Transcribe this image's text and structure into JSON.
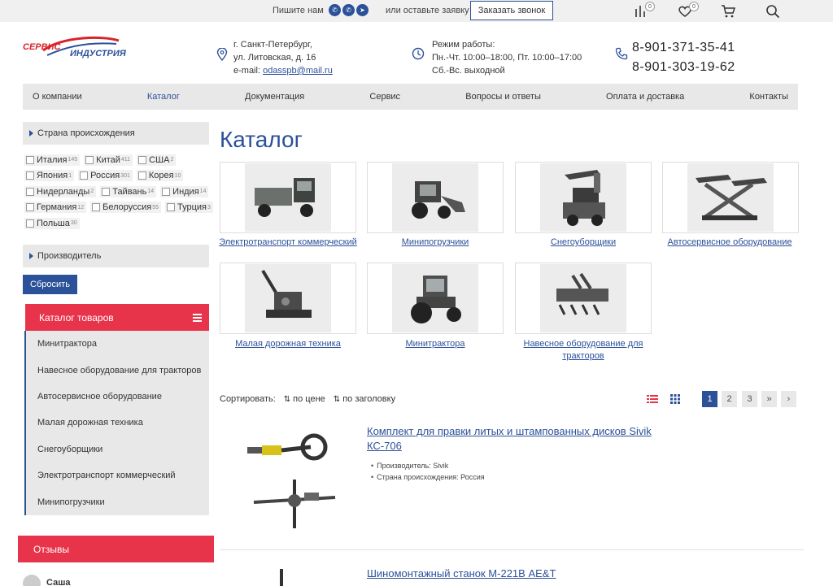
{
  "topbar": {
    "write_label": "Пишите нам",
    "messengers": [
      "whatsapp-icon",
      "viber-icon",
      "telegram-icon"
    ],
    "or_leave_label": "или оставьте заявку",
    "call_button": "Заказать звонок",
    "compare_count": "0",
    "favorites_count": "0"
  },
  "header": {
    "logo": {
      "part1": "СЕРВИС",
      "part2": "ИНДУСТРИЯ"
    },
    "address": {
      "line1": "г. Санкт-Петербург,",
      "line2": "ул. Литовская, д. 16",
      "email_label": "e-mail:",
      "email": "odasspb@mail.ru"
    },
    "hours": {
      "title": "Режим работы:",
      "line1": "Пн.-Чт. 10:00–18:00, Пт. 10:00–17:00",
      "line2": "Сб.-Вс. выходной"
    },
    "phones": [
      "8-901-371-35-41",
      "8-901-303-19-62"
    ]
  },
  "nav": {
    "items": [
      "О компании",
      "Каталог",
      "Документация",
      "Сервис",
      "Вопросы и ответы",
      "Оплата и доставка",
      "Контакты"
    ],
    "active": "Каталог"
  },
  "sidebar": {
    "country_filter_title": "Страна происхождения",
    "countries": [
      [
        {
          "name": "Италия",
          "count": "145"
        },
        {
          "name": "Китай",
          "count": "411"
        },
        {
          "name": "США",
          "count": "2"
        }
      ],
      [
        {
          "name": "Япония",
          "count": "1"
        },
        {
          "name": "Россия",
          "count": "301"
        },
        {
          "name": "Корея",
          "count": "10"
        }
      ],
      [
        {
          "name": "Нидерланды",
          "count": "2"
        },
        {
          "name": "Тайвань",
          "count": "14"
        },
        {
          "name": "Индия",
          "count": "14"
        }
      ],
      [
        {
          "name": "Германия",
          "count": "12"
        },
        {
          "name": "Белоруссия",
          "count": "55"
        },
        {
          "name": "Турция",
          "count": "3"
        }
      ],
      [
        {
          "name": "Польша",
          "count": "30"
        }
      ]
    ],
    "manufacturer_filter_title": "Производитель",
    "reset_button": "Сбросить",
    "catalog_title": "Каталог товаров",
    "catalog_items": [
      "Минитрактора",
      "Навесное оборудование для тракторов",
      "Автосервисное оборудование",
      "Малая дорожная техника",
      "Снегоуборщики",
      "Электротранспорт коммерческий",
      "Минипогрузчики"
    ],
    "reviews_title": "Отзывы",
    "review_author": "Саша"
  },
  "main": {
    "title": "Каталог",
    "categories": [
      {
        "label": "Электротранспорт коммерческий"
      },
      {
        "label": "Минипогрузчики"
      },
      {
        "label": "Снегоуборщики"
      },
      {
        "label": "Автосервисное оборудование"
      },
      {
        "label": "Малая дорожная техника"
      },
      {
        "label": "Минитрактора"
      },
      {
        "label": "Навесное оборудование для тракторов"
      }
    ],
    "sort": {
      "label": "Сортировать:",
      "by_price": "по цене",
      "by_title": "по заголовку"
    },
    "pagination": [
      "1",
      "2",
      "3",
      "»",
      "›"
    ],
    "active_page": "1",
    "products": [
      {
        "title": "Комплект для правки литых и штампованных дисков Sivik КС-706",
        "props": [
          "Производитель: Sivik",
          "Страна происхождения: Россия"
        ]
      },
      {
        "title": "Шиномонтажный станок М-221В AE&T"
      }
    ]
  }
}
